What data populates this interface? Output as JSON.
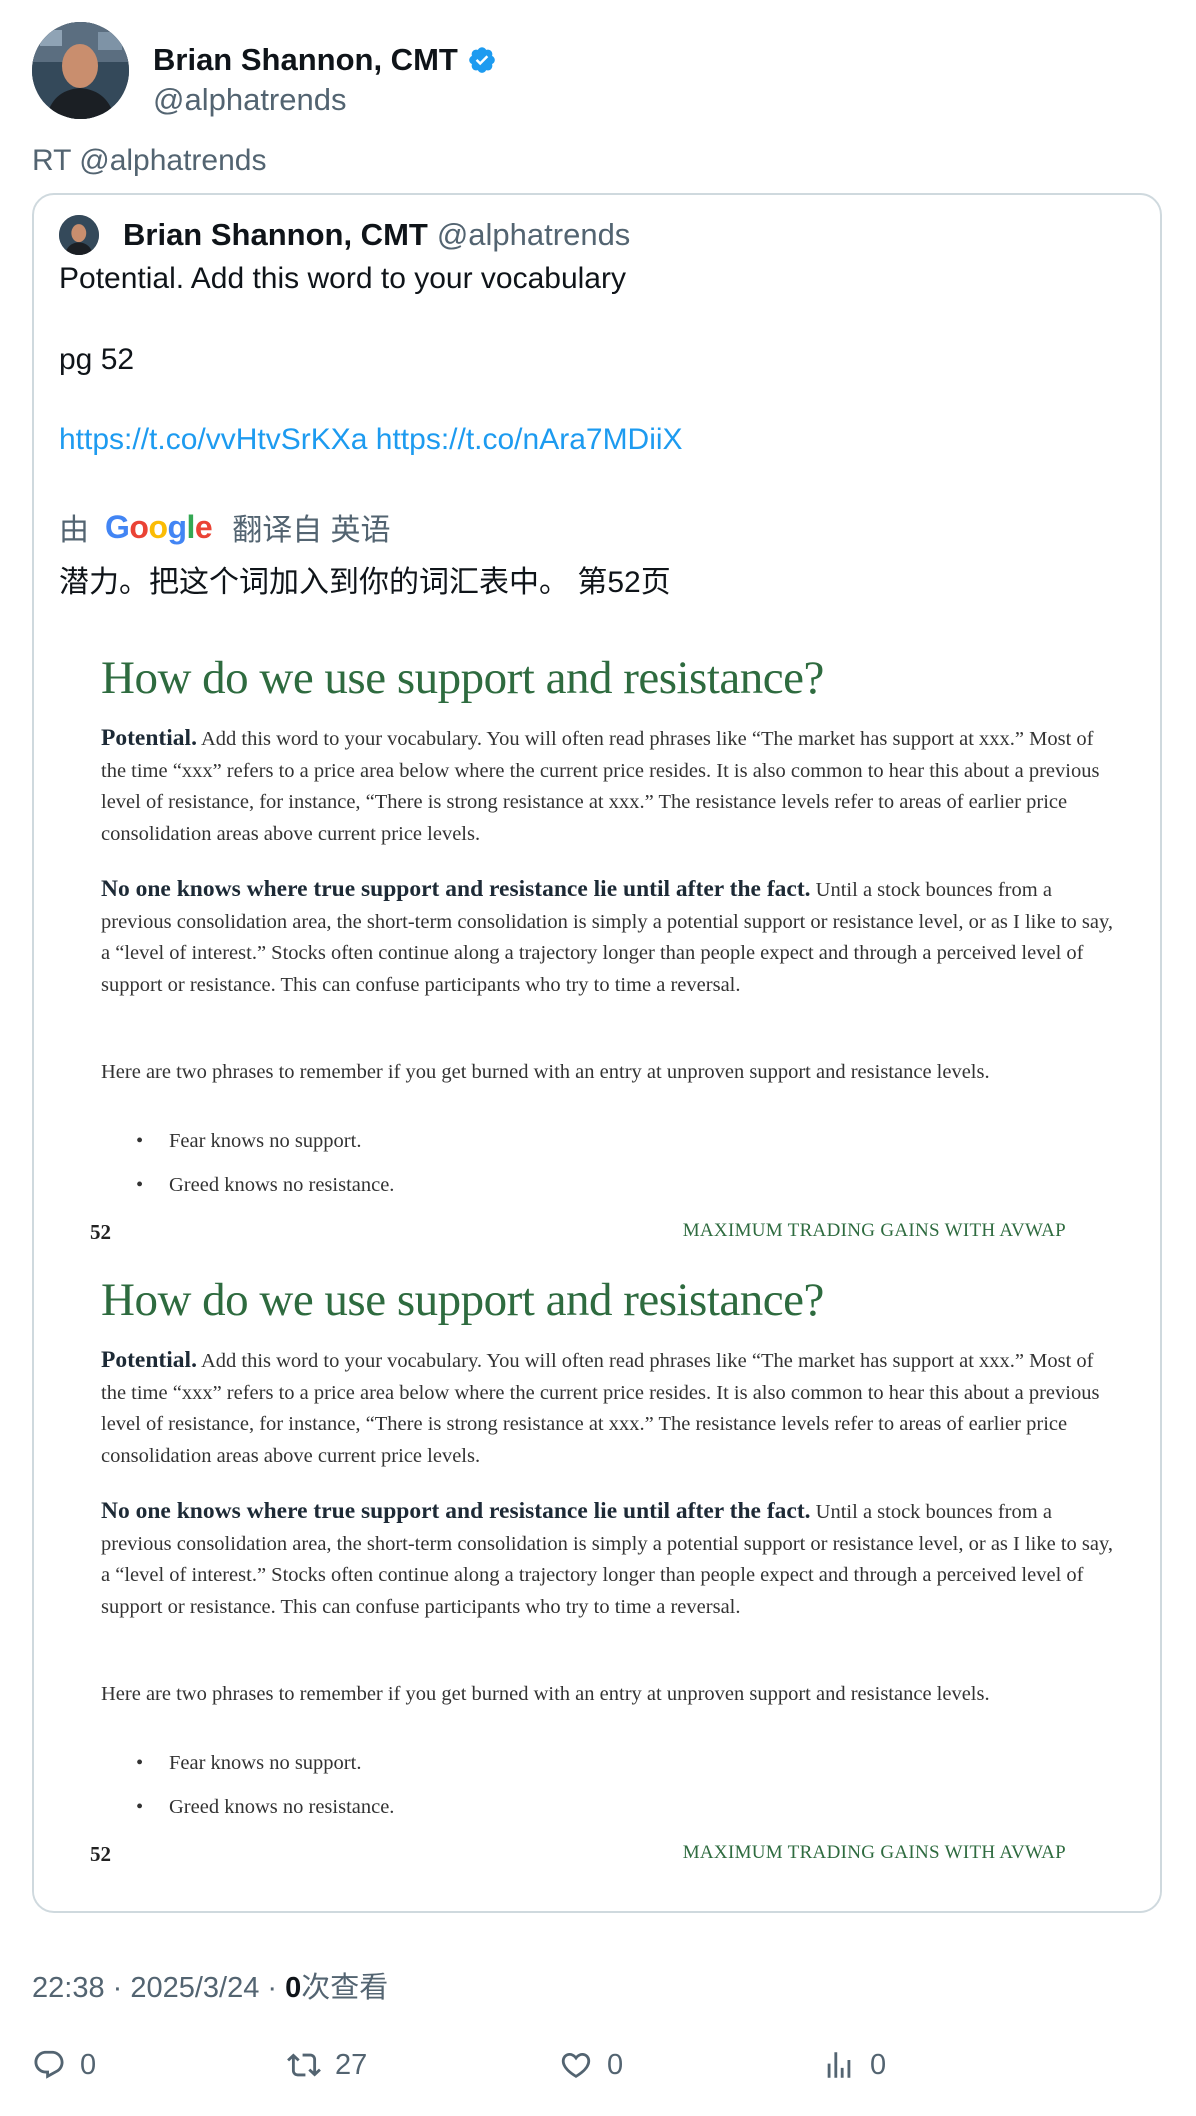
{
  "author": {
    "name": "Brian Shannon, CMT",
    "handle": "@alphatrends"
  },
  "retweet_label": "RT @alphatrends",
  "quoted": {
    "name": "Brian Shannon, CMT",
    "handle": "@alphatrends",
    "line1": "Potential.  Add this word to your vocabulary",
    "line2": "pg 52",
    "link1": "https://t.co/vvHtvSrKXa",
    "link2": "https://t.co/nAra7MDiiX",
    "translate_by": "由",
    "translate_from": "翻译自 英语",
    "translation": "潜力。把这个词加入到你的词汇表中。 第52页"
  },
  "book_page": {
    "heading": "How do we use support and resistance?",
    "p1_bold": "Potential.",
    "p1_text": " Add this word to your vocabulary. You will often read phrases like “The market has support at xxx.” Most of the time “xxx” refers to a price area below where the current price resides. It is also common to hear this about a previous level of resistance, for instance, “There is strong resistance at xxx.” The resistance levels refer to areas of earlier price consolidation areas above current price levels.",
    "p2_bold": "No one knows where true support and resistance lie until after the fact.",
    "p2_text": " Until a stock bounces from a previous consolidation area, the short-term consolidation is simply a potential support or resistance level, or as I like to say, a “level of interest.” Stocks often continue along a trajectory longer than people expect and through a perceived level of support or resistance. This can confuse participants who try to time a reversal.",
    "p3_text": "Here are two phrases to remember if you get burned with an entry at unproven support and resistance levels.",
    "bullet1": "Fear knows no support.",
    "bullet2": "Greed knows no resistance.",
    "page_number": "52",
    "running_title": "MAXIMUM TRADING GAINS WITH AVWAP"
  },
  "meta": {
    "time": "22:38 · 2025/3/24 · ",
    "views_count": "0",
    "views_label": "次查看"
  },
  "actions": {
    "replies": "0",
    "retweets": "27",
    "likes": "0",
    "views": "0"
  },
  "colors": {
    "link": "#1d9bf0",
    "verified": "#1d9bf0",
    "secondary_text": "#536471",
    "book_heading": "#2e6b3f"
  }
}
